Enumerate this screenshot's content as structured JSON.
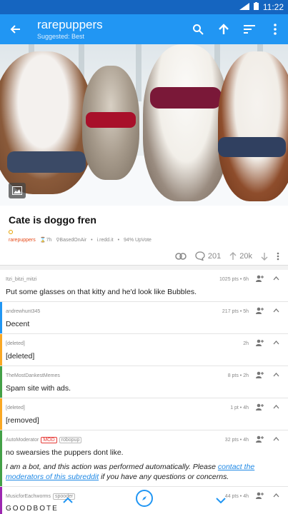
{
  "status": {
    "time": "11:22"
  },
  "appbar": {
    "title": "rarepuppers",
    "subtitle": "Suggested: Best"
  },
  "post": {
    "title": "Cate is doggo fren",
    "subreddit": "rarepuppers",
    "age": "7h",
    "author": "BasedOnAir",
    "domain": "i.redd.it",
    "upvote_ratio": "94% UpVote",
    "comments": "201",
    "score": "20k"
  },
  "comments": [
    {
      "author": "Itzi_bitzi_mitzi",
      "tags": [],
      "meta": "1025 pts • 6h",
      "body": "Put some glasses on that kitty and he'd look like Bubbles.",
      "bar": ""
    },
    {
      "author": "andrewhunt345",
      "tags": [],
      "meta": "217 pts • 5h",
      "body": "Decent",
      "bar": "#2196f3"
    },
    {
      "author": "[deleted]",
      "tags": [],
      "meta": "2h",
      "body": "[deleted]",
      "bar": "#f9a825"
    },
    {
      "author": "TheMostDankestMemes",
      "tags": [],
      "meta": "8 pts • 2h",
      "body": "Spam site with ads.",
      "bar": "#43a047"
    },
    {
      "author": "[deleted]",
      "tags": [],
      "meta": "1 pt • 4h",
      "body": "[removed]",
      "bar": "#f9a825"
    },
    {
      "author": "AutoModerator",
      "tags": [
        "MOD",
        "robopup"
      ],
      "meta": "32 pts • 4h",
      "body": "no swearsies the puppers dont like.",
      "body2_prefix": "I am a bot, and this action was performed automatically. Please ",
      "body2_link": "contact the moderators of this subreddit",
      "body2_suffix": " if you have any questions or concerns.",
      "bar": "#43a047"
    },
    {
      "author": "MusicforEachworms",
      "tags": [
        "spooder"
      ],
      "meta": "44 pts • 4h",
      "body": "GOODBOTE",
      "bar": "#9c27b0"
    }
  ],
  "icons": {
    "back": "arrow-back-icon",
    "search": "search-icon",
    "up": "arrow-up-icon",
    "sort": "sort-icon",
    "more": "more-vert-icon",
    "link": "link-icon",
    "comment": "comment-icon",
    "upvote": "upvote-icon",
    "downvote": "downvote-icon",
    "reply": "reply-icon",
    "collapse": "chevron-up-icon",
    "explore": "compass-icon"
  },
  "colors": {
    "primary": "#2196f3",
    "primary_dark": "#1565c0",
    "subreddit": "#e64a19"
  }
}
